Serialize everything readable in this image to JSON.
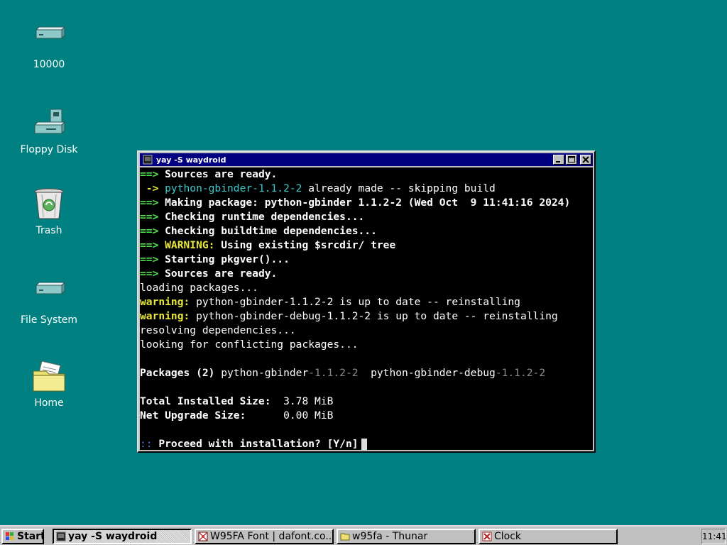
{
  "desktop": {
    "icons": [
      {
        "label": "10000",
        "icon": "hard-drive-icon"
      },
      {
        "label": "Floppy Disk",
        "icon": "floppy-disk-icon"
      },
      {
        "label": "Trash",
        "icon": "trash-icon"
      },
      {
        "label": "File System",
        "icon": "hard-drive-icon"
      },
      {
        "label": "Home",
        "icon": "home-folder-icon"
      }
    ]
  },
  "window": {
    "title": "yay -S waydroid",
    "buttons": {
      "minimize": "_",
      "maximize": "□",
      "close": "×"
    }
  },
  "terminal": {
    "l1_arrow": "==>",
    "l1_text": " Sources are ready.",
    "l2_arrow": " ->",
    "l2_pkg": " python-gbinder-1.1.2-2",
    "l2_text": " already made -- skipping build",
    "l3_arrow": "==>",
    "l3_text": " Making package: python-gbinder 1.1.2-2 (Wed Oct  9 11:41:16 2024)",
    "l4_arrow": "==>",
    "l4_text": " Checking runtime dependencies...",
    "l5_arrow": "==>",
    "l5_text": " Checking buildtime dependencies...",
    "l6_arrow": "==>",
    "l6_warn": " WARNING:",
    "l6_text": " Using existing $srcdir/ tree",
    "l7_arrow": "==>",
    "l7_text": " Starting pkgver()...",
    "l8_arrow": "==>",
    "l8_text": " Sources are ready.",
    "l9_text": "loading packages...",
    "l10_warn": "warning:",
    "l10_text": " python-gbinder-1.1.2-2 is up to date -- reinstalling",
    "l11_warn": "warning:",
    "l11_text": " python-gbinder-debug-1.1.2-2 is up to date -- reinstalling",
    "l12_text": "resolving dependencies...",
    "l13_text": "looking for conflicting packages...",
    "l15_label": "Packages (2)",
    "l15_pkg1": " python-gbinder",
    "l15_ver1": "-1.1.2-2",
    "l15_pkg2": "  python-gbinder-debug",
    "l15_ver2": "-1.1.2-2",
    "l17_label": "Total Installed Size:",
    "l17_value": "  3.78 MiB",
    "l18_label": "Net Upgrade Size:",
    "l18_value": "      0.00 MiB",
    "l20_prefix": "::",
    "l20_text": " Proceed with installation? [Y/n]"
  },
  "taskbar": {
    "start": "Start",
    "tasks": [
      {
        "label": "yay -S waydroid",
        "active": true
      },
      {
        "label": "W95FA Font | dafont.co...",
        "active": false
      },
      {
        "label": "w95fa - Thunar",
        "active": false
      },
      {
        "label": "Clock",
        "active": false
      }
    ],
    "clock": "11:41"
  }
}
